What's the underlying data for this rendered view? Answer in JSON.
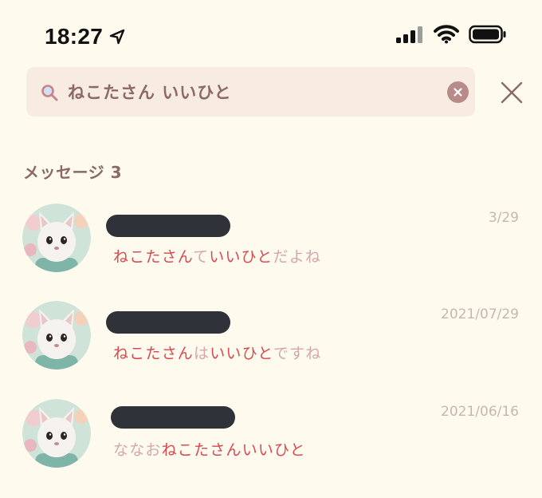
{
  "status_bar": {
    "time": "18:27",
    "icons": [
      "location-arrow-icon",
      "cellular-signal-icon",
      "wifi-icon",
      "battery-icon"
    ]
  },
  "search": {
    "query": "ねこたさん いいひと",
    "icon": "search-icon"
  },
  "section": {
    "label": "メッセージ 3"
  },
  "results": [
    {
      "date": "3/29",
      "snippet": [
        {
          "text": "ねこたさん",
          "hl": true
        },
        {
          "text": "て",
          "hl": false
        },
        {
          "text": "いいひと",
          "hl": true
        },
        {
          "text": "だよね",
          "hl": false
        }
      ]
    },
    {
      "date": "2021/07/29",
      "snippet": [
        {
          "text": "ねこたさん",
          "hl": true
        },
        {
          "text": "は",
          "hl": false
        },
        {
          "text": "いいひと",
          "hl": true
        },
        {
          "text": "ですね",
          "hl": false
        }
      ]
    },
    {
      "date": "2021/06/16",
      "snippet": [
        {
          "text": "ななお",
          "hl": false
        },
        {
          "text": "ねこたさん",
          "hl": true
        },
        {
          "text": "いいひと",
          "hl": true
        }
      ]
    }
  ],
  "colors": {
    "background": "#fefbee",
    "search_bg": "#f7ebe2",
    "highlight": "#d8484e",
    "muted": "#d4a7ac",
    "date": "#c7b6b0",
    "header": "#8a6a62"
  }
}
